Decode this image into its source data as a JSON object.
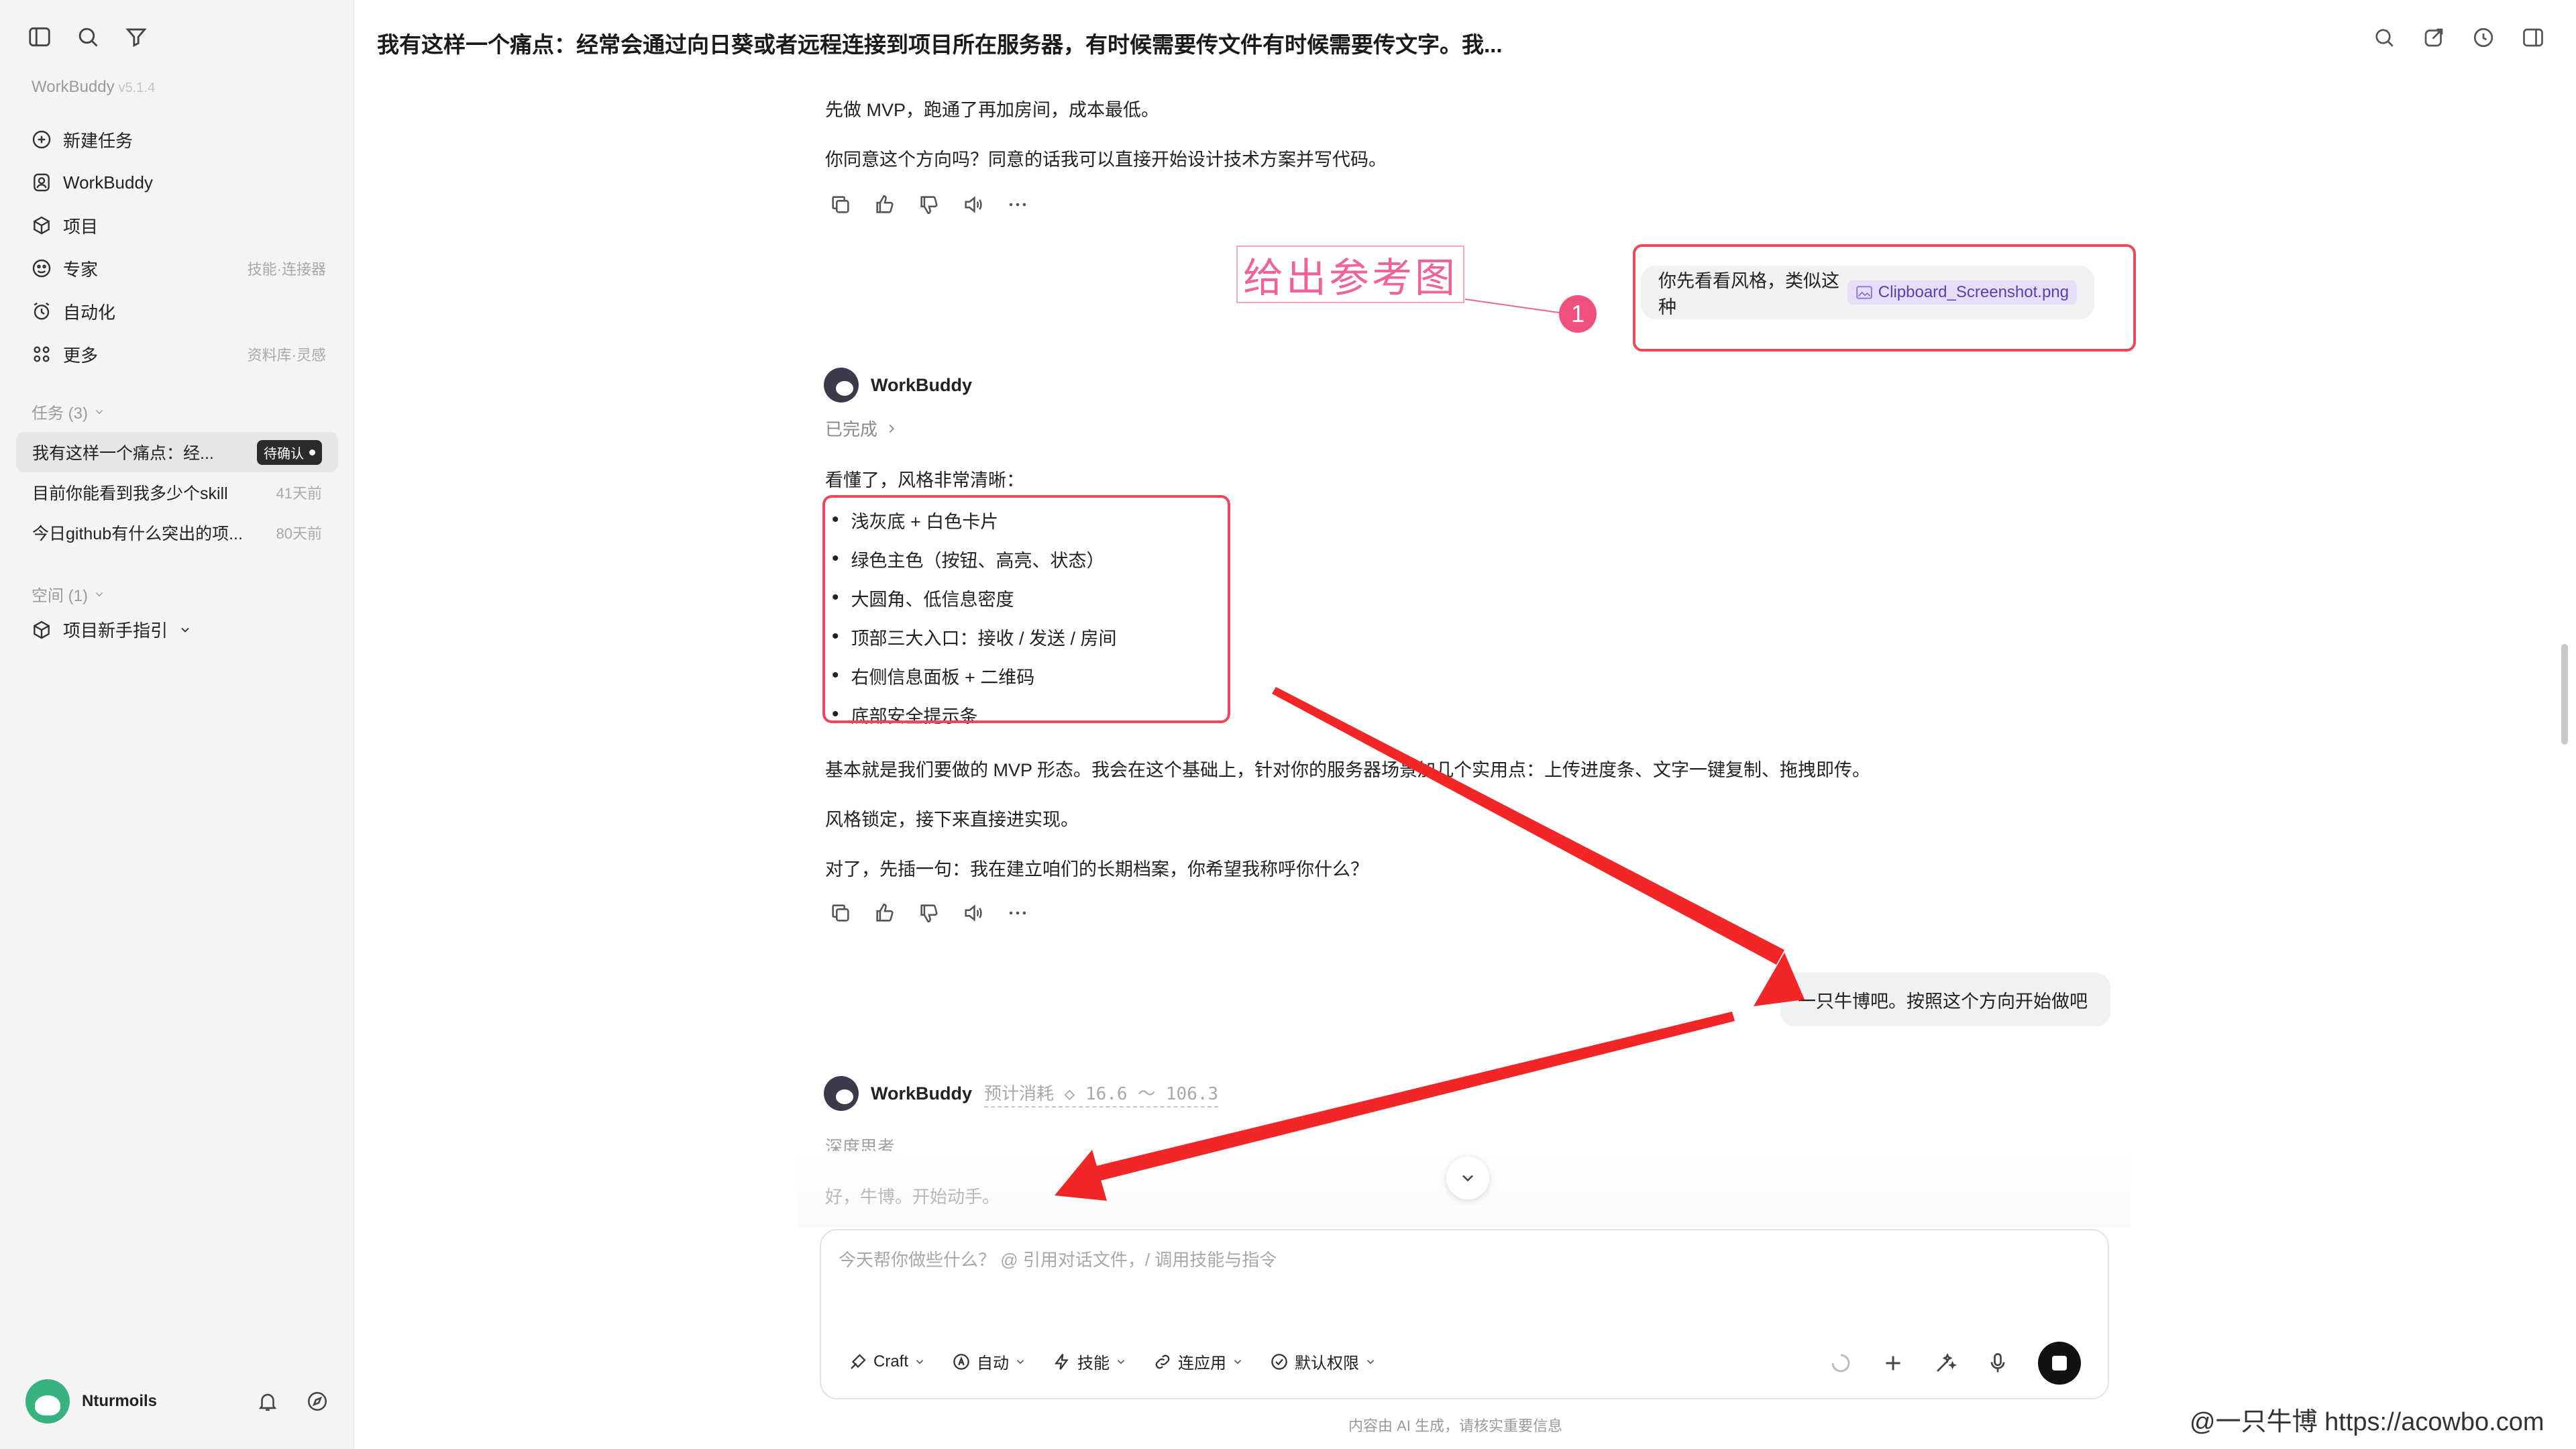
{
  "sidebar": {
    "brand": "WorkBuddy",
    "version": "v5.1.4",
    "nav": [
      {
        "label": "新建任务",
        "icon": "plus-circle-icon",
        "hint": ""
      },
      {
        "label": "WorkBuddy",
        "icon": "buddy-icon",
        "hint": ""
      },
      {
        "label": "项目",
        "icon": "project-icon",
        "hint": ""
      },
      {
        "label": "专家",
        "icon": "expert-icon",
        "hint": "技能·连接器"
      },
      {
        "label": "自动化",
        "icon": "alarm-clock-icon",
        "hint": ""
      },
      {
        "label": "更多",
        "icon": "grid-icon",
        "hint": "资料库·灵感"
      }
    ],
    "tasks_label": "任务 (3)",
    "tasks": [
      {
        "title": "我有这样一个痛点：经...",
        "badge": "待确认",
        "age": ""
      },
      {
        "title": "目前你能看到我多少个skill",
        "badge": "",
        "age": "41天前"
      },
      {
        "title": "今日github有什么突出的项...",
        "badge": "",
        "age": "80天前"
      }
    ],
    "spaces_label": "空间 (1)",
    "space_item": "项目新手指引",
    "user_name": "Nturmoils"
  },
  "header": {
    "title": "我有这样一个痛点：经常会通过向日葵或者远程连接到项目所在服务器，有时候需要传文件有时候需要传文字。我..."
  },
  "chat": {
    "msg1_line1": "先做 MVP，跑通了再加房间，成本最低。",
    "msg1_line2": "你同意这个方向吗？同意的话我可以直接开始设计技术方案并写代码。",
    "user1_text": "你先看看风格，类似这种",
    "user1_file": "Clipboard_Screenshot.png",
    "bot_name": "WorkBuddy",
    "done_label": "已完成",
    "msg2_intro": "看懂了，风格非常清晰：",
    "msg2_bullets": [
      "浅灰底 + 白色卡片",
      "绿色主色（按钮、高亮、状态）",
      "大圆角、低信息密度",
      "顶部三大入口：接收 / 发送 / 房间",
      "右侧信息面板 + 二维码",
      "底部安全提示条"
    ],
    "msg2_p1": "基本就是我们要做的 MVP 形态。我会在这个基础上，针对你的服务器场景加几个实用点：上传进度条、文字一键复制、拖拽即传。",
    "msg2_p2": "风格锁定，接下来直接进实现。",
    "msg2_p3": "对了，先插一句：我在建立咱们的长期档案，你希望我称呼你什么？",
    "user2_text": "一只牛博吧。按照这个方向开始做吧",
    "bot2_name": "WorkBuddy",
    "bot2_cost": "预计消耗 ◇ 16.6 ～ 106.3",
    "thinking_label": "深度思考",
    "bot2_reply": "好，牛博。开始动手。"
  },
  "annotation": {
    "label": "给出参考图",
    "number": "1"
  },
  "composer": {
    "placeholder": "今天帮你做些什么？ @ 引用对话文件，/ 调用技能与指令",
    "tools": [
      {
        "label": "Craft",
        "icon": "craft-icon"
      },
      {
        "label": "自动",
        "icon": "auto-icon"
      },
      {
        "label": "技能",
        "icon": "skill-icon"
      },
      {
        "label": "连应用",
        "icon": "link-icon"
      },
      {
        "label": "默认权限",
        "icon": "shield-check-icon"
      }
    ]
  },
  "footer": {
    "disclaimer": "内容由 AI 生成，请核实重要信息",
    "watermark": "@一只牛博 https://acowbo.com"
  },
  "colors": {
    "sidebar_bg": "#f4f4f4",
    "annotation_red": "#f0465a",
    "annotation_pink": "#f0639a",
    "file_chip_bg": "#e6dff7"
  }
}
